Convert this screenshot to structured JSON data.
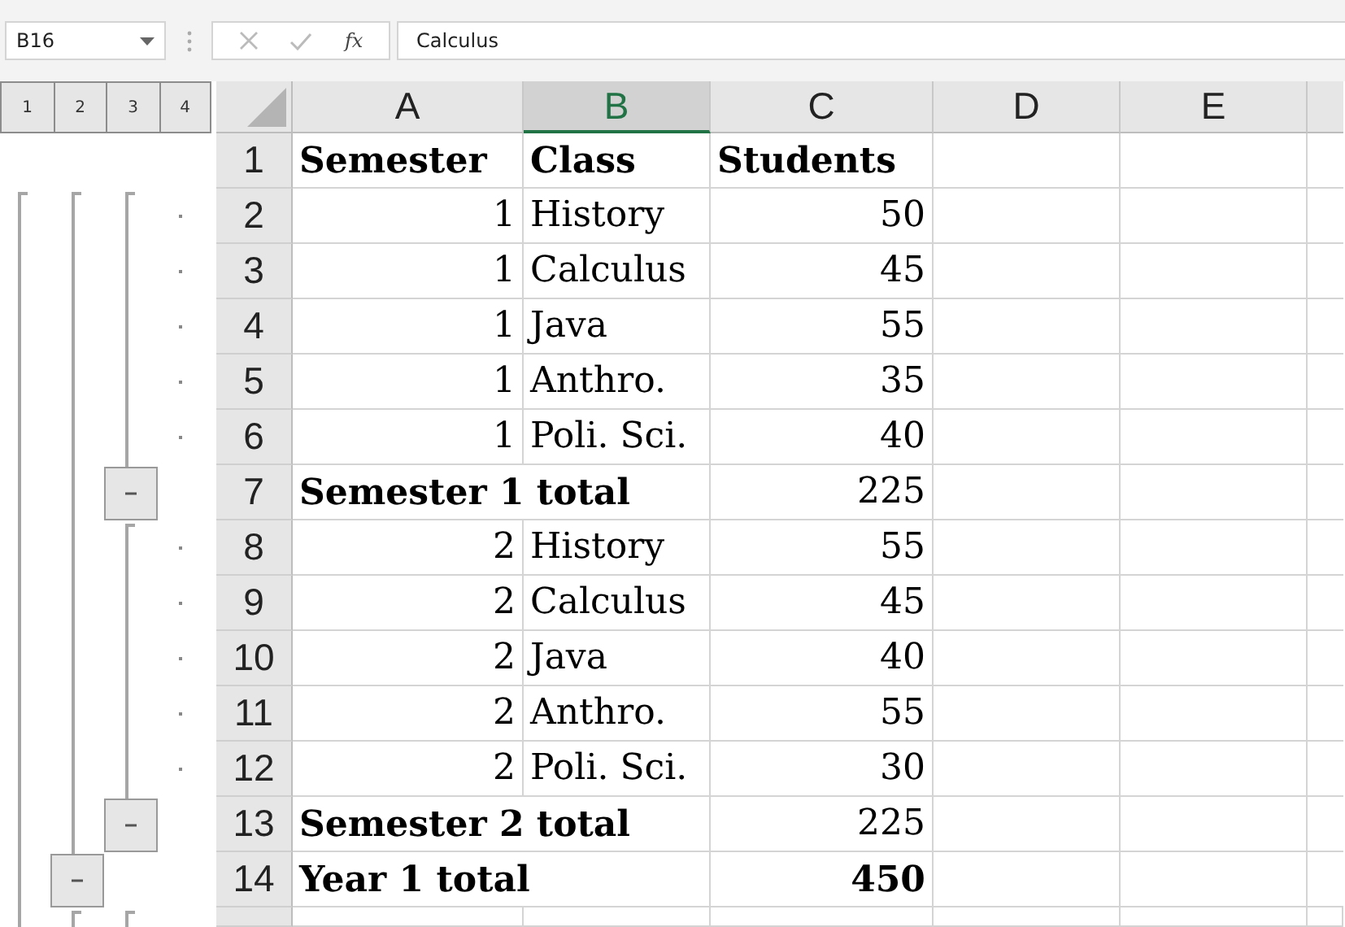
{
  "formula_bar": {
    "name_box": "B16",
    "function_label": "fx",
    "value": "Calculus"
  },
  "outline": {
    "levels": [
      "1",
      "2",
      "3",
      "4"
    ]
  },
  "grid": {
    "columns": [
      {
        "label": "A",
        "selected": false
      },
      {
        "label": "B",
        "selected": true
      },
      {
        "label": "C",
        "selected": false
      },
      {
        "label": "D",
        "selected": false
      },
      {
        "label": "E",
        "selected": false
      }
    ],
    "rows": [
      {
        "number": "1",
        "kind": "header",
        "cells": [
          "Semester",
          "Class",
          "Students"
        ]
      },
      {
        "number": "2",
        "kind": "detail",
        "cells": [
          "1",
          "History",
          "50"
        ]
      },
      {
        "number": "3",
        "kind": "detail",
        "cells": [
          "1",
          "Calculus",
          "45"
        ]
      },
      {
        "number": "4",
        "kind": "detail",
        "cells": [
          "1",
          "Java",
          "55"
        ]
      },
      {
        "number": "5",
        "kind": "detail",
        "cells": [
          "1",
          "Anthro.",
          "35"
        ]
      },
      {
        "number": "6",
        "kind": "detail",
        "cells": [
          "1",
          "Poli. Sci.",
          "40"
        ]
      },
      {
        "number": "7",
        "kind": "subtotal",
        "cells": [
          "Semester 1 total",
          "225"
        ]
      },
      {
        "number": "8",
        "kind": "detail",
        "cells": [
          "2",
          "History",
          "55"
        ]
      },
      {
        "number": "9",
        "kind": "detail",
        "cells": [
          "2",
          "Calculus",
          "45"
        ]
      },
      {
        "number": "10",
        "kind": "detail",
        "cells": [
          "2",
          "Java",
          "40"
        ]
      },
      {
        "number": "11",
        "kind": "detail",
        "cells": [
          "2",
          "Anthro.",
          "55"
        ]
      },
      {
        "number": "12",
        "kind": "detail",
        "cells": [
          "2",
          "Poli. Sci.",
          "30"
        ]
      },
      {
        "number": "13",
        "kind": "subtotal",
        "cells": [
          "Semester 2 total",
          "225"
        ]
      },
      {
        "number": "14",
        "kind": "grandtotal",
        "cells": [
          "Year 1 total",
          "450"
        ]
      }
    ]
  }
}
